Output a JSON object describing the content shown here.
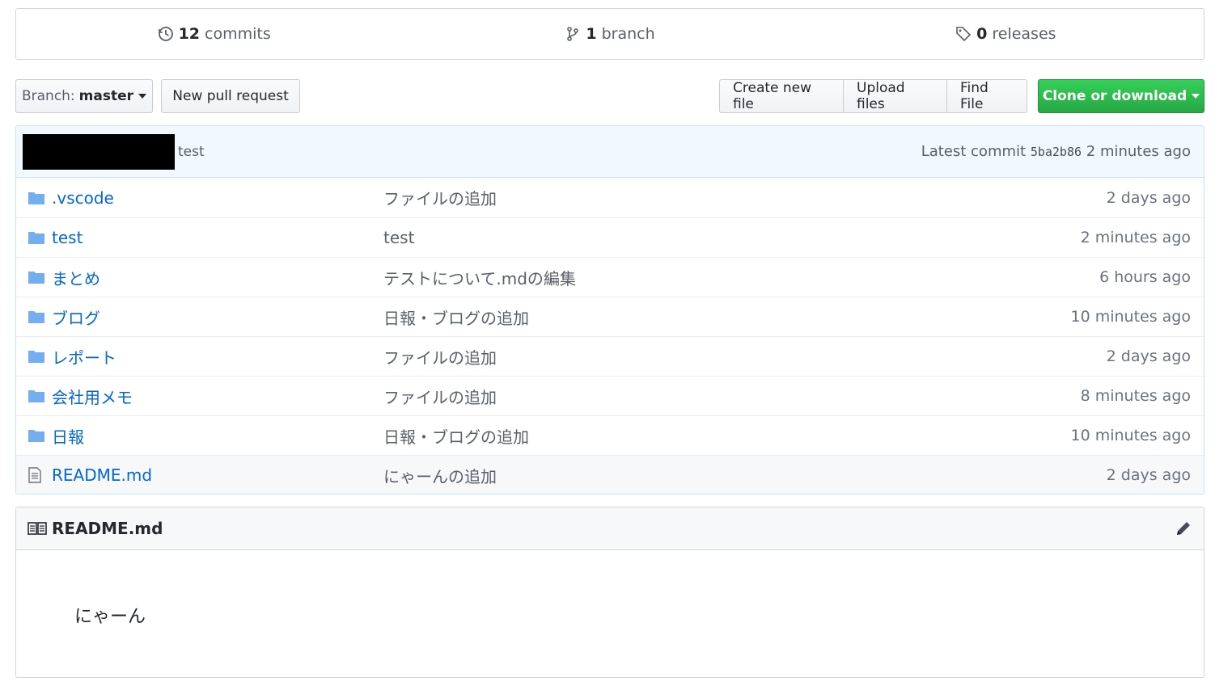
{
  "summary": {
    "commits": {
      "count": "12",
      "label": "commits"
    },
    "branches": {
      "count": "1",
      "label": "branch"
    },
    "releases": {
      "count": "0",
      "label": "releases"
    }
  },
  "toolbar": {
    "branch_label": "Branch:",
    "branch_value": "master",
    "new_pr": "New pull request",
    "create_file": "Create new file",
    "upload_files": "Upload files",
    "find_file": "Find File",
    "clone": "Clone or download"
  },
  "commit_tease": {
    "message": "test",
    "latest_label": "Latest commit",
    "sha": "5ba2b86",
    "age": "2 minutes ago"
  },
  "files": [
    {
      "icon": "folder-icon",
      "name": ".vscode",
      "message": "ファイルの追加",
      "age": "2 days ago"
    },
    {
      "icon": "folder-icon",
      "name": "test",
      "message": "test",
      "age": "2 minutes ago"
    },
    {
      "icon": "folder-icon",
      "name": "まとめ",
      "message": "テストについて.mdの編集",
      "age": "6 hours ago"
    },
    {
      "icon": "folder-icon",
      "name": "ブログ",
      "message": "日報・ブログの追加",
      "age": "10 minutes ago"
    },
    {
      "icon": "folder-icon",
      "name": "レポート",
      "message": "ファイルの追加",
      "age": "2 days ago"
    },
    {
      "icon": "folder-icon",
      "name": "会社用メモ",
      "message": "ファイルの追加",
      "age": "8 minutes ago"
    },
    {
      "icon": "folder-icon",
      "name": "日報",
      "message": "日報・ブログの追加",
      "age": "10 minutes ago"
    },
    {
      "icon": "file-icon",
      "name": "README.md",
      "message": "にゃーんの追加",
      "age": "2 days ago"
    }
  ],
  "readme": {
    "title": "README.md",
    "content": "にゃーん"
  }
}
